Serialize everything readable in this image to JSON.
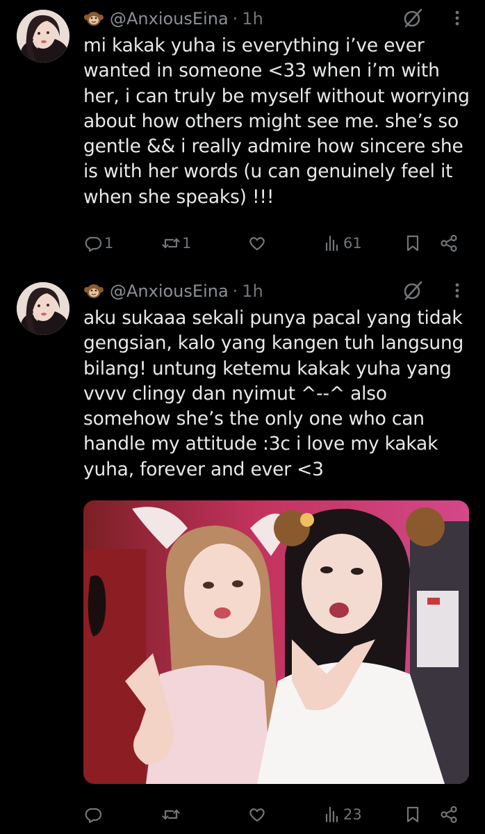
{
  "tweets": [
    {
      "display_handle": "@AnxiousEina",
      "separator": "·",
      "time": "1h",
      "text": "mi kakak yuha is everything i’ve ever\nwanted in someone <33 when i’m with\nher, i can truly be myself without worrying\nabout how others might see me. she’s so\ngentle && i really admire how sincere she\nis with her words (u can genuinely feel it\nwhen she speaks) !!!",
      "reply_count": "1",
      "repost_count": "1",
      "like_count": "",
      "view_count": "61",
      "has_media": false
    },
    {
      "display_handle": "@AnxiousEina",
      "separator": "·",
      "time": "1h",
      "text": "aku sukaaa sekali punya pacal yang tidak\ngengsian, kalo yang kangen tuh langsung\nbilang! untung ketemu kakak yuha yang\nvvvv clingy dan nyimut ^--^ also\nsomehow she’s the only one who can\nhandle my attitude :3c i love my kakak\nyuha, forever and ever <3",
      "reply_count": "",
      "repost_count": "",
      "like_count": "",
      "view_count": "23",
      "has_media": true
    }
  ],
  "icons": {
    "name_emoji": "monkey-emoji-icon",
    "grok": "grok-icon",
    "more": "more-dots-icon",
    "reply": "reply-icon",
    "repost": "repost-icon",
    "like": "heart-icon",
    "views": "views-chart-icon",
    "bookmark": "bookmark-icon",
    "share": "share-icon"
  },
  "colors": {
    "background": "#000000",
    "text": "#e7e9ea",
    "secondary": "#71767b"
  }
}
